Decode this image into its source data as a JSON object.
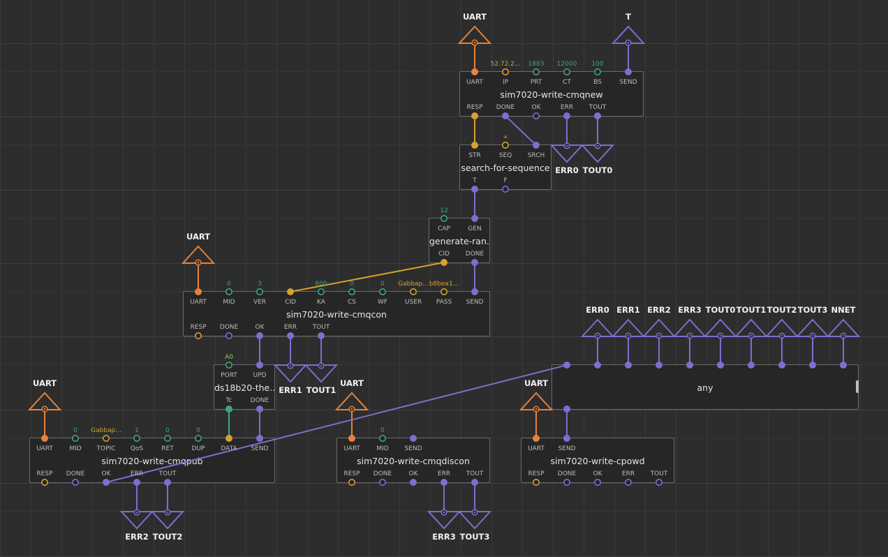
{
  "colors": {
    "background": "#2d2d2d",
    "node_body": "#262626",
    "node_border": "#6c6c6c",
    "pulse": "#7b6fd1",
    "uart": "#e8823a",
    "string": "#d8a030",
    "number": "#3fa57f",
    "boolean_text": "#8fd14f"
  },
  "nodes": {
    "cmqnew": {
      "title": "sim7020-write-cmqnew",
      "inputs": [
        "UART",
        "IP",
        "PRT",
        "CT",
        "BS",
        "SEND"
      ],
      "input_values": [
        "",
        "52.72.2...",
        "1883",
        "12000",
        "100",
        ""
      ],
      "outputs": [
        "RESP",
        "DONE",
        "OK",
        "ERR",
        "TOUT"
      ]
    },
    "search": {
      "title": "search-for-sequence",
      "inputs": [
        "STR",
        "SEQ",
        "SRCH"
      ],
      "input_values": [
        "",
        "+",
        ""
      ],
      "outputs": [
        "T",
        "F"
      ]
    },
    "generate": {
      "title": "generate-ran...",
      "inputs": [
        "CAP",
        "GEN"
      ],
      "input_values": [
        "12",
        ""
      ],
      "outputs": [
        "CID",
        "DONE"
      ]
    },
    "cmqcon": {
      "title": "sim7020-write-cmqcon",
      "inputs": [
        "UART",
        "MID",
        "VER",
        "CID",
        "KA",
        "CS",
        "WF",
        "USER",
        "PASS",
        "SEND"
      ],
      "input_values": [
        "",
        "0",
        "3",
        "",
        "600",
        "0",
        "0",
        "Gabbap...",
        "b8bea1...",
        ""
      ],
      "outputs": [
        "RESP",
        "DONE",
        "OK",
        "ERR",
        "TOUT"
      ]
    },
    "ds18b20": {
      "title": "ds18b20-the...",
      "inputs": [
        "PORT",
        "UPD"
      ],
      "input_values": [
        "A0",
        ""
      ],
      "outputs": [
        "Tc",
        "DONE"
      ]
    },
    "any": {
      "title": "any"
    },
    "cmqpub": {
      "title": "sim7020-write-cmqpub",
      "inputs": [
        "UART",
        "MID",
        "TOPIC",
        "QoS",
        "RET",
        "DUP",
        "DATA",
        "SEND"
      ],
      "input_values": [
        "",
        "0",
        "Gabbap...",
        "1",
        "0",
        "0",
        "",
        ""
      ],
      "outputs": [
        "RESP",
        "DONE",
        "OK",
        "ERR",
        "TOUT"
      ]
    },
    "cmqdiscon": {
      "title": "sim7020-write-cmqdiscon",
      "inputs": [
        "UART",
        "MID",
        "SEND"
      ],
      "input_values": [
        "",
        "0",
        ""
      ],
      "outputs": [
        "RESP",
        "DONE",
        "OK",
        "ERR",
        "TOUT"
      ]
    },
    "cpowd": {
      "title": "sim7020-write-cpowd",
      "inputs": [
        "UART",
        "SEND"
      ],
      "outputs": [
        "RESP",
        "DONE",
        "OK",
        "ERR",
        "TOUT"
      ]
    }
  },
  "terminals": {
    "uart": "UART",
    "t": "T",
    "err0": "ERR0",
    "tout0": "TOUT0",
    "err1": "ERR1",
    "tout1": "TOUT1",
    "err2": "ERR2",
    "tout2": "TOUT2",
    "err3": "ERR3",
    "tout3": "TOUT3",
    "nnet": "NNET",
    "any_inputs": [
      "ERR0",
      "ERR1",
      "ERR2",
      "ERR3",
      "TOUT0",
      "TOUT1",
      "TOUT2",
      "TOUT3",
      "NNET"
    ]
  }
}
